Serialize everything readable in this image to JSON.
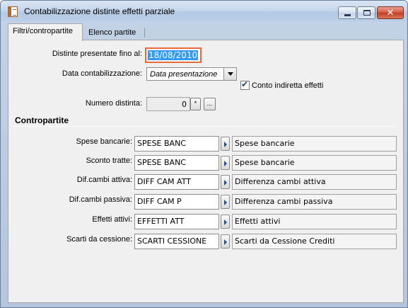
{
  "window": {
    "title": "Contabilizzazione distinte effetti parziale",
    "close_label": "✕"
  },
  "tabs": [
    {
      "label": "Filtri/contropartite",
      "active": true
    },
    {
      "label": "Elenco partite",
      "active": false
    }
  ],
  "filters": {
    "distinte_label": "Distinte presentate fino al:",
    "distinte_value": "18/08/2010",
    "data_contab_label": "Data contabilizzazione:",
    "data_contab_value": "Data presentazione",
    "conto_indiretta_label": "Conto indiretta effetti",
    "conto_indiretta_checked": true,
    "numero_distinta_label": "Numero distinta:",
    "numero_distinta_value": "0",
    "numero_zoom_label": "*",
    "numero_browse_label": "..."
  },
  "contropartite": {
    "section_title": "Contropartite",
    "rows": [
      {
        "label": "Spese bancarie:",
        "code": "SPESE BANC",
        "description": "Spese bancarie"
      },
      {
        "label": "Sconto tratte:",
        "code": "SPESE BANC",
        "description": "Spese bancarie"
      },
      {
        "label": "Dif.cambi attiva:",
        "code": "DIFF CAM ATT",
        "description": "Differenza cambi attiva"
      },
      {
        "label": "Dif.cambi passiva:",
        "code": "DIFF CAM P",
        "description": "Differenza cambi passiva"
      },
      {
        "label": "Effetti attivi:",
        "code": "EFFETTI ATT",
        "description": "Effetti attivi"
      },
      {
        "label": "Scarti da cessione:",
        "code": "SCARTI CESSIONE",
        "description": "Scarti da Cessione Crediti"
      }
    ]
  },
  "colors": {
    "title_bar": "#c6d7ec",
    "close_button": "#c23b1f",
    "date_focus_border": "#e86a3c",
    "selection": "#3399ff",
    "panel": "#f0f0f0"
  }
}
